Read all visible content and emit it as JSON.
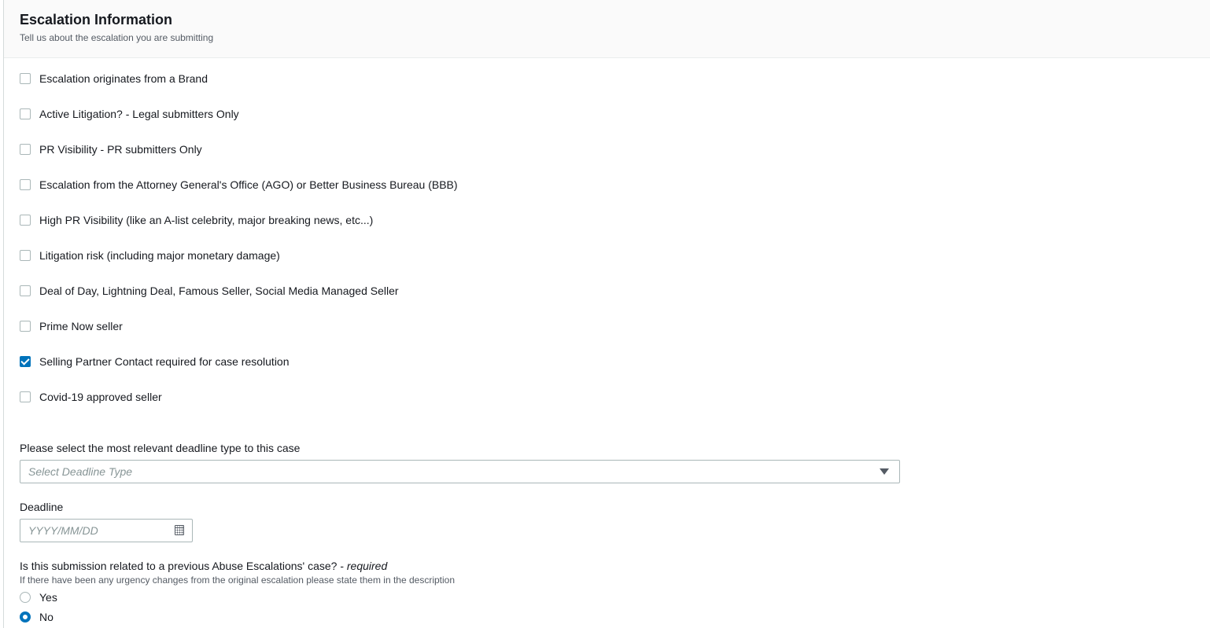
{
  "section": {
    "title": "Escalation Information",
    "subtitle": "Tell us about the escalation you are submitting"
  },
  "checkboxes": [
    {
      "label": "Escalation originates from a Brand",
      "checked": false
    },
    {
      "label": "Active Litigation? - Legal submitters Only",
      "checked": false
    },
    {
      "label": "PR Visibility - PR submitters Only",
      "checked": false
    },
    {
      "label": "Escalation from the Attorney General's Office (AGO) or Better Business Bureau (BBB)",
      "checked": false
    },
    {
      "label": "High PR Visibility (like an A-list celebrity, major breaking news, etc...)",
      "checked": false
    },
    {
      "label": "Litigation risk (including major monetary damage)",
      "checked": false
    },
    {
      "label": "Deal of Day, Lightning Deal, Famous Seller, Social Media Managed Seller",
      "checked": false
    },
    {
      "label": "Prime Now seller",
      "checked": false
    },
    {
      "label": "Selling Partner Contact required for case resolution",
      "checked": true
    },
    {
      "label": "Covid-19 approved seller",
      "checked": false
    }
  ],
  "deadline_type": {
    "label": "Please select the most relevant deadline type to this case",
    "placeholder": "Select Deadline Type"
  },
  "deadline": {
    "label": "Deadline",
    "placeholder": "YYYY/MM/DD"
  },
  "previous_case": {
    "question": "Is this submission related to a previous Abuse Escalations' case? - ",
    "required": "required",
    "hint": "If there have been any urgency changes from the original escalation please state them in the description",
    "options": [
      {
        "label": "Yes",
        "selected": false
      },
      {
        "label": "No",
        "selected": true
      }
    ]
  },
  "colors": {
    "accent": "#0073bb",
    "border": "#aab7b8",
    "text": "#16191f",
    "muted": "#545b64",
    "placeholder": "#879596"
  }
}
